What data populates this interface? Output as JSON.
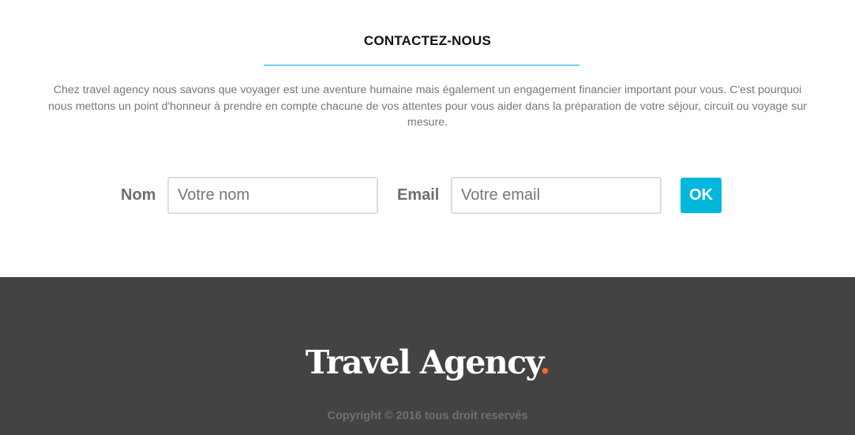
{
  "contact": {
    "title": "CONTACTEZ-NOUS",
    "intro": "Chez travel agency nous savons que voyager est une aventure humaine mais également un engagement financier important pour vous. C'est pourquoi nous mettons un point d'honneur à prendre en compte chacune de vos attentes pour vous aider dans la préparation de votre séjour, circuit ou voyage sur mesure.",
    "accent_color": "#00b3d9"
  },
  "form": {
    "name_label": "Nom",
    "name_placeholder": "Votre nom",
    "name_value": "",
    "email_label": "Email",
    "email_placeholder": "Votre email",
    "email_value": "",
    "submit_label": "OK",
    "submit_color": "#00b8dd"
  },
  "footer": {
    "logo_text": "Travel Agency",
    "logo_dot": ".",
    "logo_dot_color": "#f26a21",
    "background_color": "#434343",
    "copyright": "Copyright © 2016 tous droit reservés"
  }
}
